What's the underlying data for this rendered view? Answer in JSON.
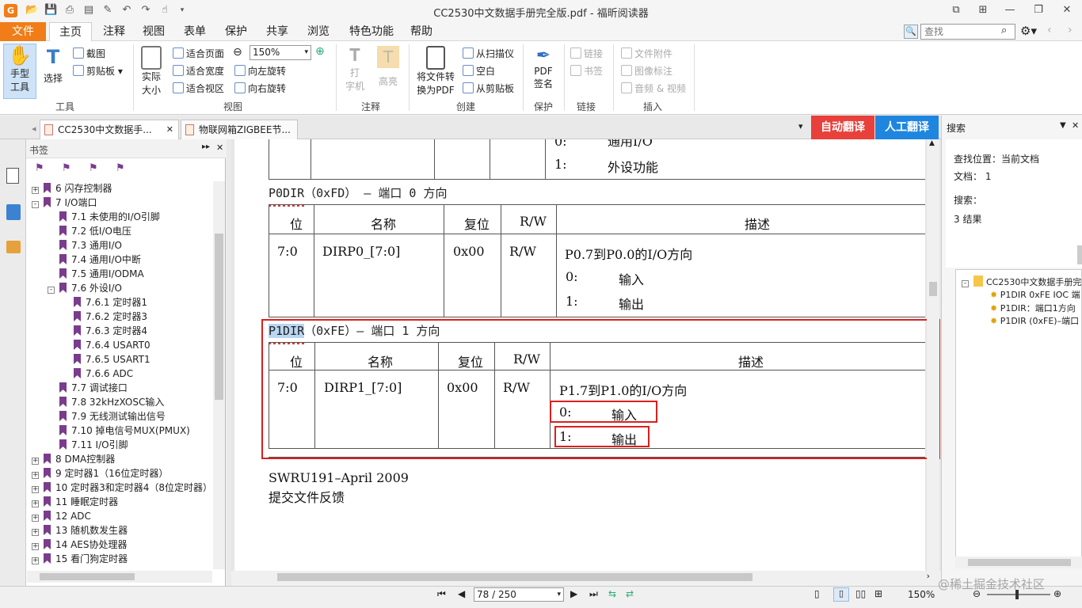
{
  "window": {
    "title": "CC2530中文数据手册完全版.pdf - 福昕阅读器"
  },
  "menu": {
    "file": "文件",
    "items": [
      "主页",
      "注释",
      "视图",
      "表单",
      "保护",
      "共享",
      "浏览",
      "特色功能",
      "帮助"
    ]
  },
  "search": {
    "placeholder": "查找"
  },
  "ribbon": {
    "hand_line1": "手型",
    "hand_line2": "工具",
    "select": "选择",
    "screenshot": "截图",
    "clipboard": "剪贴板",
    "group_tools": "工具",
    "actual_line1": "实际",
    "actual_line2": "大小",
    "fit_page": "适合页面",
    "fit_width": "适合宽度",
    "fit_visible": "适合视区",
    "zoom": "150%",
    "rotate_left": "向左旋转",
    "rotate_right": "向右旋转",
    "group_view": "视图",
    "typewriter_line1": "打",
    "typewriter_line2": "字机",
    "highlight": "高亮",
    "group_comment": "注释",
    "convert_line1": "将文件转",
    "convert_line2": "换为PDF",
    "from_scanner": "从扫描仪",
    "blank": "空白",
    "from_clipboard": "从剪贴板",
    "group_create": "创建",
    "pdf_sign_line1": "PDF",
    "pdf_sign_line2": "签名",
    "group_protect": "保护",
    "link": "链接",
    "bookmark": "书签",
    "group_link": "链接",
    "attachment": "文件附件",
    "image_annot": "图像标注",
    "audio_video": "音频 & 视频",
    "group_insert": "插入"
  },
  "tabs": [
    "CC2530中文数据手...",
    "物联网箱ZIGBEE节..."
  ],
  "translate": {
    "auto": "自动翻译",
    "manual": "人工翻译"
  },
  "bookmarks": {
    "header": "书签",
    "items": [
      {
        "label": "6  闪存控制器",
        "level": 0,
        "exp": "+"
      },
      {
        "label": "7  I/O端口",
        "level": 0,
        "exp": "-"
      },
      {
        "label": "7.1  未使用的I/O引脚",
        "level": 1
      },
      {
        "label": "7.2  低I/O电压",
        "level": 1
      },
      {
        "label": "7.3  通用I/O",
        "level": 1
      },
      {
        "label": "7.4  通用I/O中断",
        "level": 1
      },
      {
        "label": "7.5  通用I/ODMA",
        "level": 1
      },
      {
        "label": "7.6  外设I/O",
        "level": 1,
        "exp": "-"
      },
      {
        "label": "7.6.1  定时器1",
        "level": 2
      },
      {
        "label": "7.6.2  定时器3",
        "level": 2
      },
      {
        "label": "7.6.3  定时器4",
        "level": 2
      },
      {
        "label": "7.6.4  USART0",
        "level": 2
      },
      {
        "label": "7.6.5  USART1",
        "level": 2
      },
      {
        "label": "7.6.6  ADC",
        "level": 2
      },
      {
        "label": "7.7  调试接口",
        "level": 1
      },
      {
        "label": "7.8  32kHzXOSC输入",
        "level": 1
      },
      {
        "label": "7.9  无线测试输出信号",
        "level": 1
      },
      {
        "label": "7.10  掉电信号MUX(PMUX)",
        "level": 1
      },
      {
        "label": "7.11  I/O引脚",
        "level": 1
      },
      {
        "label": "8  DMA控制器",
        "level": 0,
        "exp": "+"
      },
      {
        "label": "9  定时器1（16位定时器）",
        "level": 0,
        "exp": "+"
      },
      {
        "label": "10  定时器3和定时器4（8位定时器）",
        "level": 0,
        "exp": "+"
      },
      {
        "label": "11  睡眠定时器",
        "level": 0,
        "exp": "+"
      },
      {
        "label": "12  ADC",
        "level": 0,
        "exp": "+"
      },
      {
        "label": "13  随机数发生器",
        "level": 0,
        "exp": "+"
      },
      {
        "label": "14  AES协处理器",
        "level": 0,
        "exp": "+"
      },
      {
        "label": "15  看门狗定时器",
        "level": 0,
        "exp": "+"
      }
    ]
  },
  "doc": {
    "top_row0": "0:",
    "top_row0_text": "通用I/O",
    "top_row1": "1:",
    "top_row1_text": "外设功能",
    "p0_title": "P0DIR（0xFD） – 端口 0 方向",
    "p1_name": "P1DIR",
    "p1_title_rest": "（0xFE）– 端口 1 方向",
    "headers": {
      "bit": "位",
      "name": "名称",
      "reset": "复位",
      "rw": "R/W",
      "desc": "描述"
    },
    "p0_row": {
      "bit": "7:0",
      "name": "DIRP0_[7:0]",
      "reset": "0x00",
      "rw": "R/W",
      "desc": "P0.7到P0.0的I/O方向",
      "v0": "0:",
      "v0t": "输入",
      "v1": "1:",
      "v1t": "输出"
    },
    "p1_row": {
      "bit": "7:0",
      "name": "DIRP1_[7:0]",
      "reset": "0x00",
      "rw": "R/W",
      "desc": "P1.7到P1.0的I/O方向",
      "v0": "0:",
      "v0t": "输入",
      "v1": "1:",
      "v1t": "输出"
    },
    "footer1": "SWRU191–April 2009",
    "footer2": "提交文件反馈"
  },
  "search_panel": {
    "title": "搜索",
    "location_label": "查找位置：",
    "location_value": "当前文档",
    "doc_label": "文档：",
    "doc_value": "1",
    "search_label": "搜索：",
    "results_count": "3 结果",
    "root": "CC2530中文数据手册完",
    "results": [
      "P1DIR 0xFE IOC 端",
      "P1DIR：端口1方向",
      "P1DIR (0xFE)–端口"
    ]
  },
  "status": {
    "page": "78 / 250",
    "zoom": "150%",
    "watermark": "@稀土掘金技术社区"
  }
}
